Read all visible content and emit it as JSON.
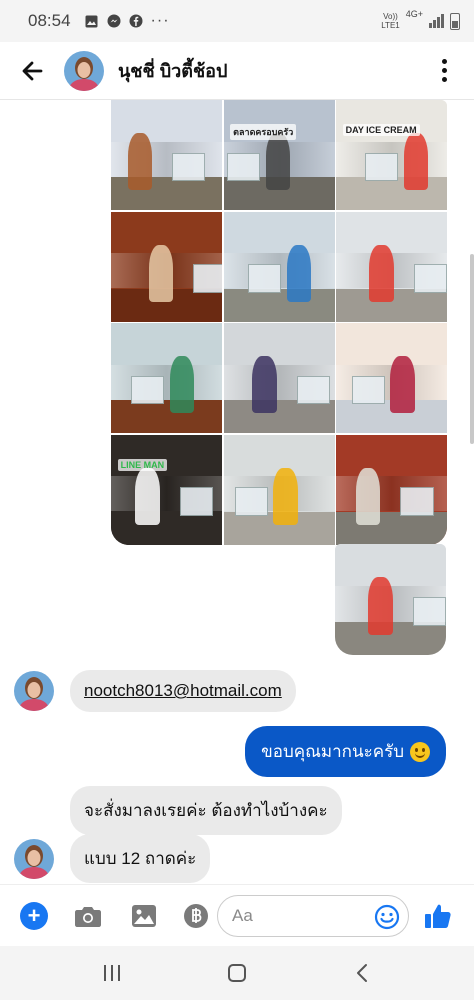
{
  "status_bar": {
    "time": "08:54",
    "more_indicator": "···",
    "network_top": "Vo))",
    "network_mid": "4G+",
    "network_bottom": "LTE1",
    "icons": [
      "gallery-icon",
      "messenger-icon",
      "facebook-icon",
      "signal-icon",
      "battery-icon"
    ]
  },
  "header": {
    "contact_name": "นุชชี่ บิวตี้ช้อป",
    "back_icon": "arrow-left-icon",
    "more_icon": "vertical-dots-icon"
  },
  "photo_grid": {
    "tiles": [
      {
        "name": "vendor-at-stall",
        "sky": "#d7dde6",
        "floor": "#7a7160",
        "accent": "#a85b2a"
      },
      {
        "name": "market-gate-sign",
        "sky": "#b8c2cf",
        "floor": "#6d6a62",
        "accent": "#444444",
        "label": "ตลาดครอบครัว"
      },
      {
        "name": "ice-cream-freezer",
        "sky": "#e9e7e1",
        "floor": "#bcb7ad",
        "accent": "#e23a2e",
        "label": "DAY ICE CREAM"
      },
      {
        "name": "food-menu-poster",
        "sky": "#8c3a1c",
        "floor": "#6b2a12",
        "accent": "#e6c9a6"
      },
      {
        "name": "market-stalls",
        "sky": "#cfd9e0",
        "floor": "#8a8a80",
        "accent": "#2a78c4"
      },
      {
        "name": "vendor-with-freezer",
        "sky": "#dfe3e6",
        "floor": "#9e9a92",
        "accent": "#e23a2e"
      },
      {
        "name": "food-counter",
        "sky": "#c6d4d8",
        "floor": "#7b3b1e",
        "accent": "#2f8a5a"
      },
      {
        "name": "market-vendors",
        "sky": "#d3d7da",
        "floor": "#8e8a84",
        "accent": "#3c3360"
      },
      {
        "name": "ice-cream-scoops",
        "sky": "#f2e6dc",
        "floor": "#c9cfd6",
        "accent": "#b21f3d"
      },
      {
        "name": "line-man-poster",
        "sky": "#2f2a26",
        "floor": "#2f2a26",
        "accent": "#ffffff",
        "label": "LINE MAN"
      },
      {
        "name": "handing-product",
        "sky": "#d8dcdc",
        "floor": "#a8a49c",
        "accent": "#f2b10a"
      },
      {
        "name": "stall-banner",
        "sky": "#a33a26",
        "floor": "#7d7a72",
        "accent": "#e2e2d8"
      }
    ],
    "single_photo": {
      "name": "freezer-stall",
      "sky": "#d9dde0",
      "floor": "#8a877f",
      "accent": "#e23a2e"
    }
  },
  "messages": [
    {
      "id": "email",
      "direction": "in",
      "text": "nootch8013@hotmail.com",
      "is_link": true
    },
    {
      "id": "thanks",
      "direction": "out",
      "text": "ขอบคุณมากนะครับ",
      "emoji": "smile-emoji"
    },
    {
      "id": "order",
      "direction": "in",
      "text": "จะสั่งมาลงเรยค่ะ ต้องทำไงบ้างคะ"
    },
    {
      "id": "trays",
      "direction": "in",
      "text": "แบบ 12 ถาดค่ะ"
    }
  ],
  "composer": {
    "placeholder": "Aa",
    "icons": [
      "plus-icon",
      "camera-icon",
      "image-icon",
      "baht-icon",
      "emoji-icon",
      "thumbs-up-icon"
    ]
  },
  "nav_bar": {
    "icons": [
      "recent-apps-icon",
      "home-icon",
      "back-icon"
    ]
  },
  "colors": {
    "accent_blue": "#1877f2",
    "outgoing_bubble": "#0a58c7",
    "incoming_bubble": "#eaeaea"
  }
}
